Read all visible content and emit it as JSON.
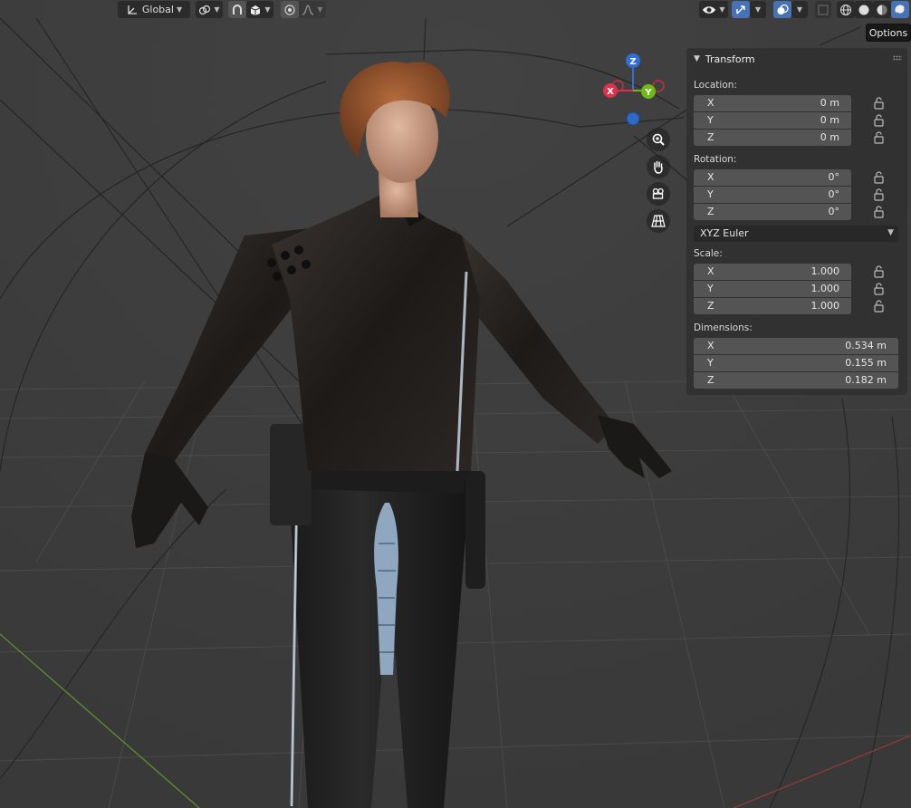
{
  "header": {
    "orientation_label": "Global",
    "orientation_icon": "transform-orientation-icon",
    "pivot_icon": "pivot-point-icon",
    "snap_icon": "snap-magnet-icon",
    "snap_target_icon": "snap-increment-icon",
    "proportional_icon": "proportional-edit-icon",
    "falloff_icon": "falloff-curve-icon",
    "visibility_icon": "eye-visibility-icon",
    "gizmo_icon": "gizmo-toggle-icon",
    "overlay_icon": "overlays-icon",
    "xray_icon": "xray-icon",
    "shading_modes": [
      "wireframe",
      "solid",
      "material-preview",
      "rendered"
    ],
    "active_shading": "rendered"
  },
  "tooltip": {
    "text": "Options"
  },
  "panel": {
    "title": "Transform",
    "location": {
      "label": "Location:",
      "rows": [
        {
          "axis": "X",
          "value": "0 m"
        },
        {
          "axis": "Y",
          "value": "0 m"
        },
        {
          "axis": "Z",
          "value": "0 m"
        }
      ]
    },
    "rotation": {
      "label": "Rotation:",
      "rows": [
        {
          "axis": "X",
          "value": "0°"
        },
        {
          "axis": "Y",
          "value": "0°"
        },
        {
          "axis": "Z",
          "value": "0°"
        }
      ],
      "mode": "XYZ Euler"
    },
    "scale": {
      "label": "Scale:",
      "rows": [
        {
          "axis": "X",
          "value": "1.000"
        },
        {
          "axis": "Y",
          "value": "1.000"
        },
        {
          "axis": "Z",
          "value": "1.000"
        }
      ]
    },
    "dimensions": {
      "label": "Dimensions:",
      "rows": [
        {
          "axis": "X",
          "value": "0.534 m"
        },
        {
          "axis": "Y",
          "value": "0.155 m"
        },
        {
          "axis": "Z",
          "value": "0.182 m"
        }
      ]
    }
  },
  "gizmo": {
    "axes": [
      {
        "label": "Z",
        "color": "#2f6fd6"
      },
      {
        "label": "X",
        "color": "#e0304a"
      },
      {
        "label": "Y",
        "color": "#6dbb14"
      }
    ]
  },
  "nav_buttons": [
    "zoom-icon",
    "hand-pan-icon",
    "camera-icon",
    "grid-perspective-icon"
  ],
  "colors": {
    "viewport_bg": "#3d3d3d",
    "panel_bg": "#303030",
    "field_bg": "#545454",
    "accent": "#4772b3"
  }
}
